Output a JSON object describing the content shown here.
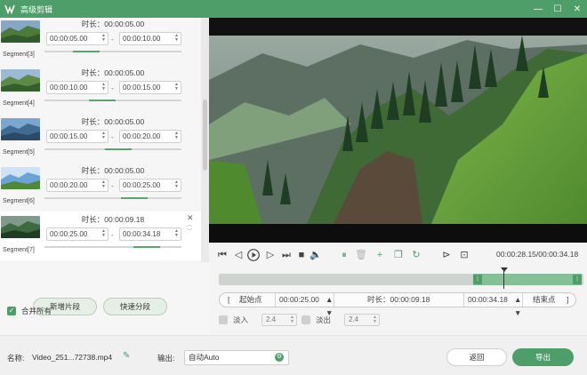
{
  "window": {
    "title": "高级剪辑",
    "minimize_icon": "—",
    "maximize_icon": "☐",
    "close_icon": "✕"
  },
  "segments": [
    {
      "label": "Segment[3]",
      "duration": "时长：00:00:05.00",
      "start": "00:00:05.00",
      "end": "00:00:10.00",
      "progress": 0.25
    },
    {
      "label": "Segment[4]",
      "duration": "时长：00:00:05.00",
      "start": "00:00:10.00",
      "end": "00:00:15.00",
      "progress": 0.4
    },
    {
      "label": "Segment[5]",
      "duration": "时长：00:00:05.00",
      "start": "00:00:15.00",
      "end": "00:00:20.00",
      "progress": 0.55
    },
    {
      "label": "Segment[6]",
      "duration": "时长：00:00:05.00",
      "start": "00:00:20.00",
      "end": "00:00:25.00",
      "progress": 0.7
    },
    {
      "label": "Segment[7]",
      "duration": "时长：00:00:09.18",
      "start": "00:00:25.00",
      "end": "00:00:34.18",
      "progress": 0.82,
      "active": true
    }
  ],
  "segment_dash": "-",
  "left_actions": {
    "add_segment": "新增片段",
    "quick_split": "快速分段",
    "merge_all": "合并所有",
    "merge_checked": true
  },
  "controls": {
    "timecode": "00:00:28.15/00:00:34.18"
  },
  "range": {
    "start_button": "起始点",
    "start_time": "00:00:25.00",
    "duration": "时长：00:00:09.18",
    "end_time": "00:00:34.18",
    "end_button": "结束点",
    "bracket_open": "[",
    "bracket_close": "]"
  },
  "fade": {
    "fade_in_label": "淡入",
    "fade_in_value": "2.4",
    "fade_out_label": "淡出",
    "fade_out_value": "2.4"
  },
  "bottom": {
    "name_label": "名称:",
    "file_name": "Video_251...72738.mp4",
    "output_label": "输出:",
    "output_value": "自动Auto",
    "back_button": "返回",
    "export_button": "导出"
  },
  "colors": {
    "accent": "#4e9e6a",
    "titlebar": "#4e9e6a",
    "timeline_selection": "#86c099"
  }
}
